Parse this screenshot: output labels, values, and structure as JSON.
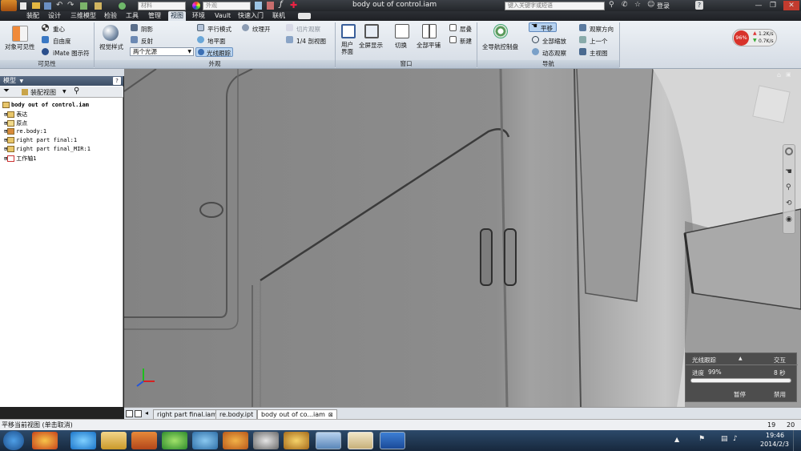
{
  "titlebar": {
    "title": "body out of control.iam",
    "quick_box1": "材料",
    "quick_box2": "外观",
    "search_placeholder": "键入关键字或短语",
    "login": "登录",
    "help": "?",
    "minimize": "—",
    "restore": "❐",
    "close": "✕"
  },
  "menu": {
    "items": [
      "装配",
      "设计",
      "三维模型",
      "检验",
      "工具",
      "管理",
      "视图",
      "环境",
      "Vault",
      "快速入门",
      "联机"
    ],
    "active_index": 6
  },
  "ribbon": {
    "visibility": {
      "title": "可见性",
      "object_visibility": "对象可见性",
      "center_of_gravity": "重心",
      "dof": "自由度",
      "imate_glyph": "iMate 图示符"
    },
    "appearance": {
      "title": "外观",
      "visual_style": "视觉样式",
      "shadows": "阴影",
      "reflections": "反射",
      "lighting_value": "两个光源",
      "parallel_mode": "平行模式",
      "ground_plane": "地平面",
      "ray_tracing": "光线跟踪",
      "texture_on": "纹理开",
      "section_view": "切片观察",
      "quarter_section": "1/4 剖视图"
    },
    "window": {
      "title": "窗口",
      "user_interface": "用户界面",
      "full_screen": "全屏显示",
      "switch": "切换",
      "tile_all": "全部平铺",
      "cascade": "层叠",
      "new": "新建"
    },
    "navigate": {
      "title": "导航",
      "steering_wheels": "全导航控制盘",
      "pan": "平移",
      "zoom_all": "全部缩放",
      "orbit": "动态观察",
      "look_at": "观察方向",
      "previous": "上一个",
      "home": "主视图"
    },
    "net_monitor": {
      "percent": "96%",
      "up": "1.2K/s",
      "down": "0.7K/s"
    }
  },
  "model_panel": {
    "title": "模型",
    "view_mode": "装配视图",
    "tree": [
      "body out of control.iam",
      "表达",
      "原点",
      "re.body:1",
      "right part final:1",
      "right part final_MIR:1",
      "工作轴1"
    ]
  },
  "progress": {
    "title": "光线跟踪",
    "mode": "交互",
    "label": "进度",
    "percent_text": "99%",
    "percent_value": 99,
    "time": "8 秒",
    "pause": "暂停",
    "disable": "禁用"
  },
  "doc_tabs": [
    "right part final.iam",
    "re.body.ipt",
    "body out of co...iam"
  ],
  "doc_tab_active": 2,
  "status": {
    "message": "平移当前视图 (单击取消)",
    "num1": "19",
    "num2": "20"
  },
  "taskbar": {
    "time": "19:46",
    "date": "2014/2/3"
  },
  "colors": {
    "ribbon_bg": "#dfe5ec",
    "title_bg": "#2a2d31",
    "active_pan": "#b6d2f0",
    "net_red": "#d8322a"
  }
}
